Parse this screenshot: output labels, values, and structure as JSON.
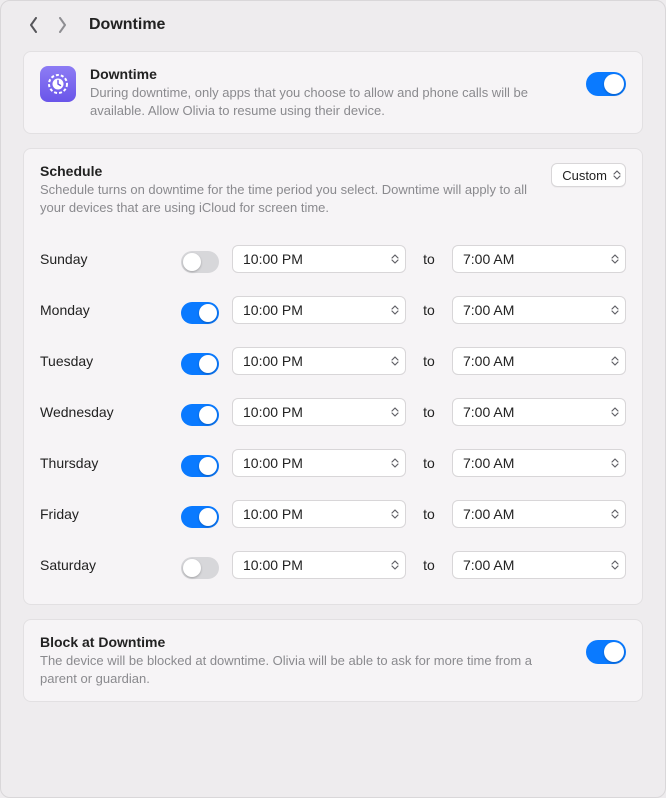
{
  "header": {
    "title": "Downtime"
  },
  "downtime_card": {
    "title": "Downtime",
    "description": "During downtime, only apps that you choose to allow and phone calls will be available. Allow Olivia to resume using their device.",
    "enabled": true
  },
  "schedule": {
    "title": "Schedule",
    "description": "Schedule turns on downtime for the time period you select. Downtime will apply to all your devices that are using iCloud for screen time.",
    "mode_label": "Custom",
    "to_label": "to",
    "days": [
      {
        "name": "Sunday",
        "enabled": false,
        "start": "10:00 PM",
        "end": "7:00 AM"
      },
      {
        "name": "Monday",
        "enabled": true,
        "start": "10:00 PM",
        "end": "7:00 AM"
      },
      {
        "name": "Tuesday",
        "enabled": true,
        "start": "10:00 PM",
        "end": "7:00 AM"
      },
      {
        "name": "Wednesday",
        "enabled": true,
        "start": "10:00 PM",
        "end": "7:00 AM"
      },
      {
        "name": "Thursday",
        "enabled": true,
        "start": "10:00 PM",
        "end": "7:00 AM"
      },
      {
        "name": "Friday",
        "enabled": true,
        "start": "10:00 PM",
        "end": "7:00 AM"
      },
      {
        "name": "Saturday",
        "enabled": false,
        "start": "10:00 PM",
        "end": "7:00 AM"
      }
    ]
  },
  "block_card": {
    "title": "Block at Downtime",
    "description": "The device will be blocked at downtime. Olivia will be able to ask for more time from a parent or guardian.",
    "enabled": true
  },
  "colors": {
    "accent": "#0a7aff",
    "icon_gradient_top": "#8d7cf4",
    "icon_gradient_bottom": "#6a55e9"
  }
}
